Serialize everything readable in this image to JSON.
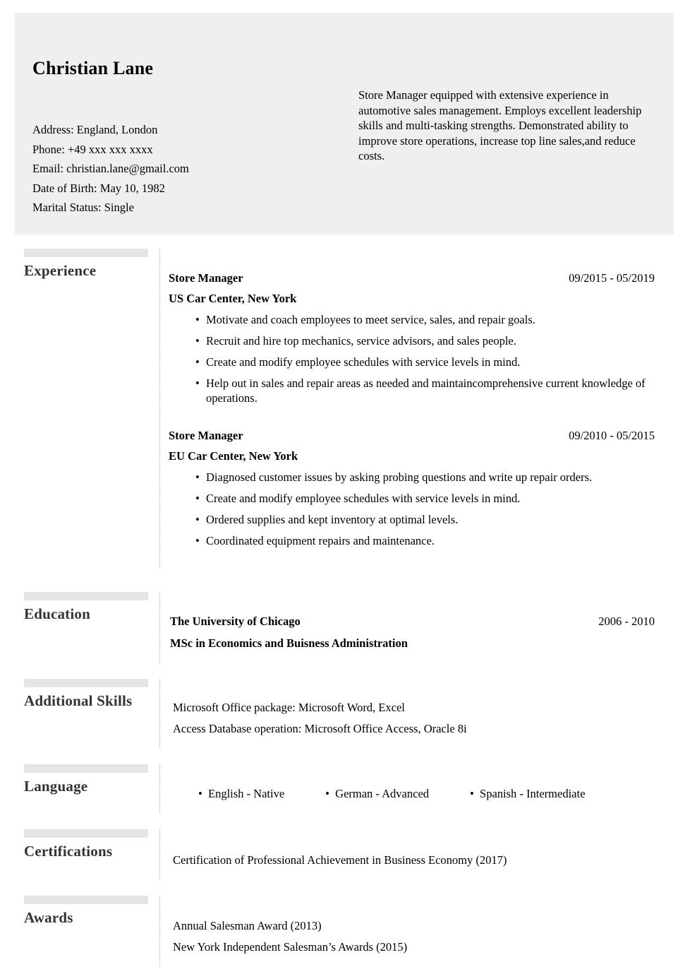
{
  "colors": {
    "header_band": "#efefef",
    "accent_bar": "#e5e5e5",
    "section_label": "#333333",
    "divider": "#bdbdbd",
    "text": "#000000"
  },
  "header": {
    "full_name": "Christian Lane",
    "contact": [
      {
        "label": "Address:",
        "value": "England, London"
      },
      {
        "label": "Phone:",
        "value": "+49 xxx xxx xxxx"
      },
      {
        "label": "Email:",
        "value": "christian.lane@gmail.com"
      },
      {
        "label": "Date of Birth:",
        "value": "May 10, 1982"
      },
      {
        "label": "Marital Status:",
        "value": "Single"
      }
    ],
    "summary": "Store Manager equipped with extensive experience in automotive sales management. Employs excellent leadership skills and multi-tasking strengths. Demonstrated ability to improve store operations, increase top line sales,and reduce costs."
  },
  "sections": {
    "experience": {
      "label": "Experience",
      "jobs": [
        {
          "title": "Store Manager",
          "dates": "09/2015 - 05/2019",
          "company": "US Car Center, New York",
          "bullets": [
            "Motivate and coach employees to meet service, sales, and repair goals.",
            "Recruit and hire top mechanics, service advisors, and sales people.",
            "Create and modify employee schedules with service levels in mind.",
            "Help out in sales and repair areas as needed and maintaincomprehensive current knowledge of operations."
          ]
        },
        {
          "title": "Store Manager",
          "dates": "09/2010 - 05/2015",
          "company": "EU Car Center, New York",
          "bullets": [
            "Diagnosed customer issues by asking probing questions and write up repair orders.",
            "Create and modify employee schedules with service levels in mind.",
            "Ordered supplies and kept inventory at optimal levels.",
            "Coordinated equipment repairs and maintenance."
          ]
        }
      ]
    },
    "education": {
      "label": "Education",
      "entries": [
        {
          "school": "The University of Chicago",
          "dates": "2006 - 2010",
          "degree": "MSc in Economics and Buisness Administration"
        }
      ]
    },
    "skills": {
      "label": "Additional Skills",
      "items": [
        "Microsoft Office package: Microsoft Word, Excel",
        "Access Database operation: Microsoft Office Access, Oracle 8i"
      ]
    },
    "language": {
      "label": "Language",
      "items": [
        "English - Native",
        "German - Advanced",
        "Spanish - Intermediate"
      ]
    },
    "certifications": {
      "label": "Certifications",
      "items": [
        "Certification of Professional Achievement in Business Economy (2017)"
      ]
    },
    "awards": {
      "label": "Awards",
      "items": [
        "Annual Salesman Award (2013)",
        "New York Independent Salesman’s Awards (2015)"
      ]
    }
  }
}
